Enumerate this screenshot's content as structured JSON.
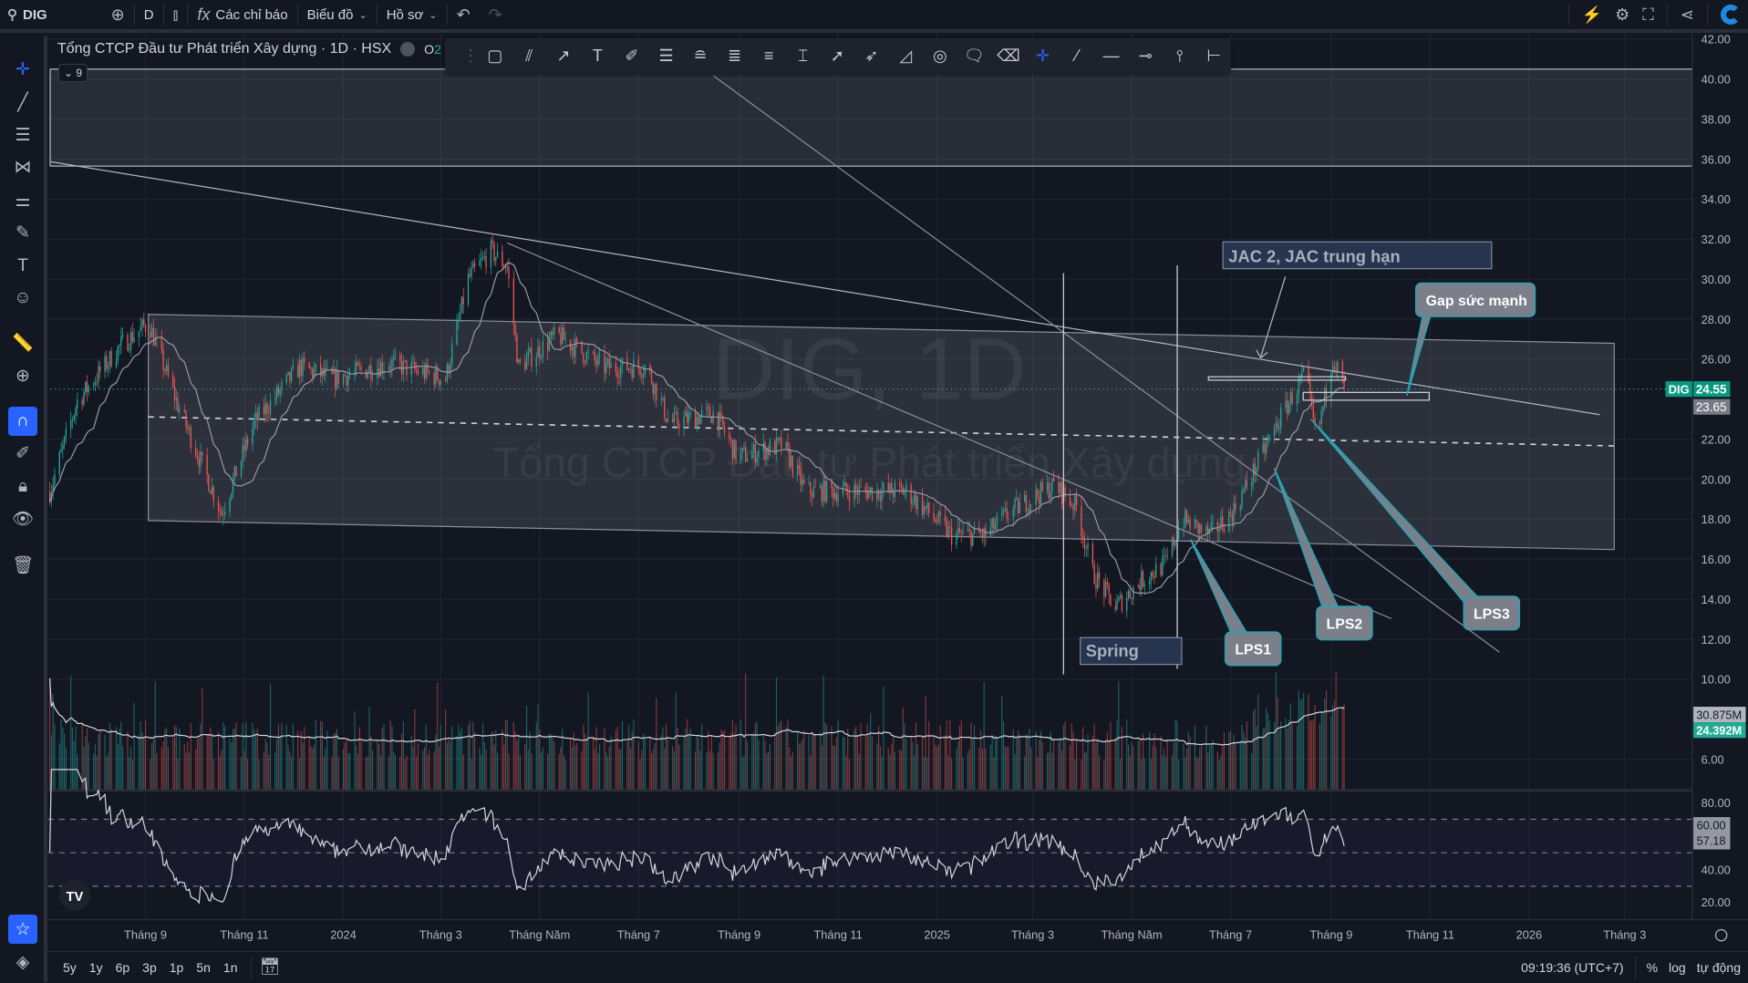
{
  "topbar": {
    "symbol": "DIG",
    "interval": "D",
    "indicators_label": "Các chỉ báo",
    "chart_label": "Biểu đồ",
    "profile_label": "Hồ sơ"
  },
  "legend": {
    "title": "Tổng CTCP Đầu tư Phát triển Xây dựng · 1D · HSX",
    "ohlc_prefix": "O",
    "ohlc_partial": "2",
    "collapse_count": "9"
  },
  "watermark": {
    "symbol_line": "DIG, 1D",
    "name_line": "Tổng CTCP Đầu tư Phát triển Xây dựng"
  },
  "annotations": {
    "jac": "JAC 2,  JAC trung hạn",
    "gap": "Gap sức mạnh",
    "lps1": "LPS1",
    "lps2": "LPS2",
    "lps3": "LPS3",
    "spring": "Spring"
  },
  "price_axis": {
    "ticks": [
      "42.00",
      "40.00",
      "38.00",
      "36.00",
      "34.00",
      "32.00",
      "30.00",
      "28.00",
      "26.00",
      "22.00",
      "20.00",
      "18.00",
      "16.00",
      "14.00",
      "12.00",
      "10.00",
      "6.00"
    ],
    "last_symbol": "DIG",
    "last_price": "24.55",
    "ma_value": "23.65",
    "volume_ma": "30.875M",
    "volume": "24.392M"
  },
  "rsi_axis": {
    "ticks": [
      "80.00",
      "40.00",
      "20.00"
    ],
    "band_upper": "60.00",
    "value": "57.18"
  },
  "time_axis": {
    "labels": [
      {
        "text": "Tháng 9",
        "date": "2023-09-01"
      },
      {
        "text": "Tháng 11",
        "date": "2023-11-01"
      },
      {
        "text": "2024",
        "date": "2024-01-01"
      },
      {
        "text": "Tháng 3",
        "date": "2024-03-01"
      },
      {
        "text": "Tháng Năm",
        "date": "2024-05-01"
      },
      {
        "text": "Tháng 7",
        "date": "2024-07-01"
      },
      {
        "text": "Tháng 9",
        "date": "2024-09-01"
      },
      {
        "text": "Tháng 11",
        "date": "2024-11-01"
      },
      {
        "text": "2025",
        "date": "2025-01-01"
      },
      {
        "text": "Tháng 3",
        "date": "2025-03-01"
      },
      {
        "text": "Tháng Năm",
        "date": "2025-05-01"
      },
      {
        "text": "Tháng 7",
        "date": "2025-07-01"
      },
      {
        "text": "Tháng 9",
        "date": "2025-09-01"
      },
      {
        "text": "Tháng 11",
        "date": "2025-11-01"
      },
      {
        "text": "2026",
        "date": "2026-01-01"
      },
      {
        "text": "Tháng 3",
        "date": "2026-03-01"
      }
    ]
  },
  "bottombar": {
    "ranges": [
      "5y",
      "1y",
      "6p",
      "3p",
      "1p",
      "5n",
      "1n"
    ],
    "clock": "09:19:36 (UTC+7)",
    "percent": "%",
    "log": "log",
    "auto": "tự động"
  },
  "colors": {
    "up": "#26a69a",
    "down": "#ef5350",
    "accent": "#2962ff",
    "callout_border": "#22a5b5"
  },
  "chart_data": {
    "type": "candlestick",
    "symbol": "DIG",
    "timeframe": "1D",
    "exchange": "HSX",
    "ylim": [
      6,
      42
    ],
    "price_path": [
      [
        "2023-07-04",
        19.4
      ],
      [
        "2023-07-21",
        23.9
      ],
      [
        "2023-08-17",
        26.7
      ],
      [
        "2023-09-03",
        27.8
      ],
      [
        "2023-09-20",
        23.9
      ],
      [
        "2023-10-18",
        18.3
      ],
      [
        "2023-11-07",
        22.8
      ],
      [
        "2023-12-05",
        25.6
      ],
      [
        "2023-12-26",
        25.0
      ],
      [
        "2024-01-29",
        25.8
      ],
      [
        "2024-03-04",
        25.0
      ],
      [
        "2024-03-18",
        30.0
      ],
      [
        "2024-04-01",
        31.4
      ],
      [
        "2024-04-11",
        30.6
      ],
      [
        "2024-04-18",
        25.6
      ],
      [
        "2024-05-12",
        27.2
      ],
      [
        "2024-06-09",
        25.6
      ],
      [
        "2024-07-06",
        25.6
      ],
      [
        "2024-07-20",
        22.8
      ],
      [
        "2024-08-17",
        23.3
      ],
      [
        "2024-08-31",
        21.1
      ],
      [
        "2024-09-28",
        21.7
      ],
      [
        "2024-10-12",
        19.4
      ],
      [
        "2024-11-15",
        19.4
      ],
      [
        "2024-12-13",
        19.4
      ],
      [
        "2025-01-10",
        17.2
      ],
      [
        "2025-01-31",
        17.2
      ],
      [
        "2025-02-14",
        18.3
      ],
      [
        "2025-03-14",
        19.7
      ],
      [
        "2025-03-28",
        18.6
      ],
      [
        "2025-04-07",
        15.3
      ],
      [
        "2025-04-21",
        13.6
      ],
      [
        "2025-05-08",
        15.0
      ],
      [
        "2025-05-22",
        15.8
      ],
      [
        "2025-06-01",
        18.0
      ],
      [
        "2025-06-18",
        17.2
      ],
      [
        "2025-07-02",
        18.3
      ],
      [
        "2025-07-16",
        20.5
      ],
      [
        "2025-07-30",
        22.8
      ],
      [
        "2025-08-16",
        25.3
      ],
      [
        "2025-08-23",
        21.9
      ],
      [
        "2025-09-02",
        26.2
      ],
      [
        "2025-09-09",
        24.55
      ]
    ],
    "last_close": 24.55,
    "ma": 23.65,
    "volume_last": "24.392M",
    "volume_ma": "30.875M",
    "rsi": 57.18,
    "rsi_bands": [
      70,
      50,
      30
    ]
  }
}
